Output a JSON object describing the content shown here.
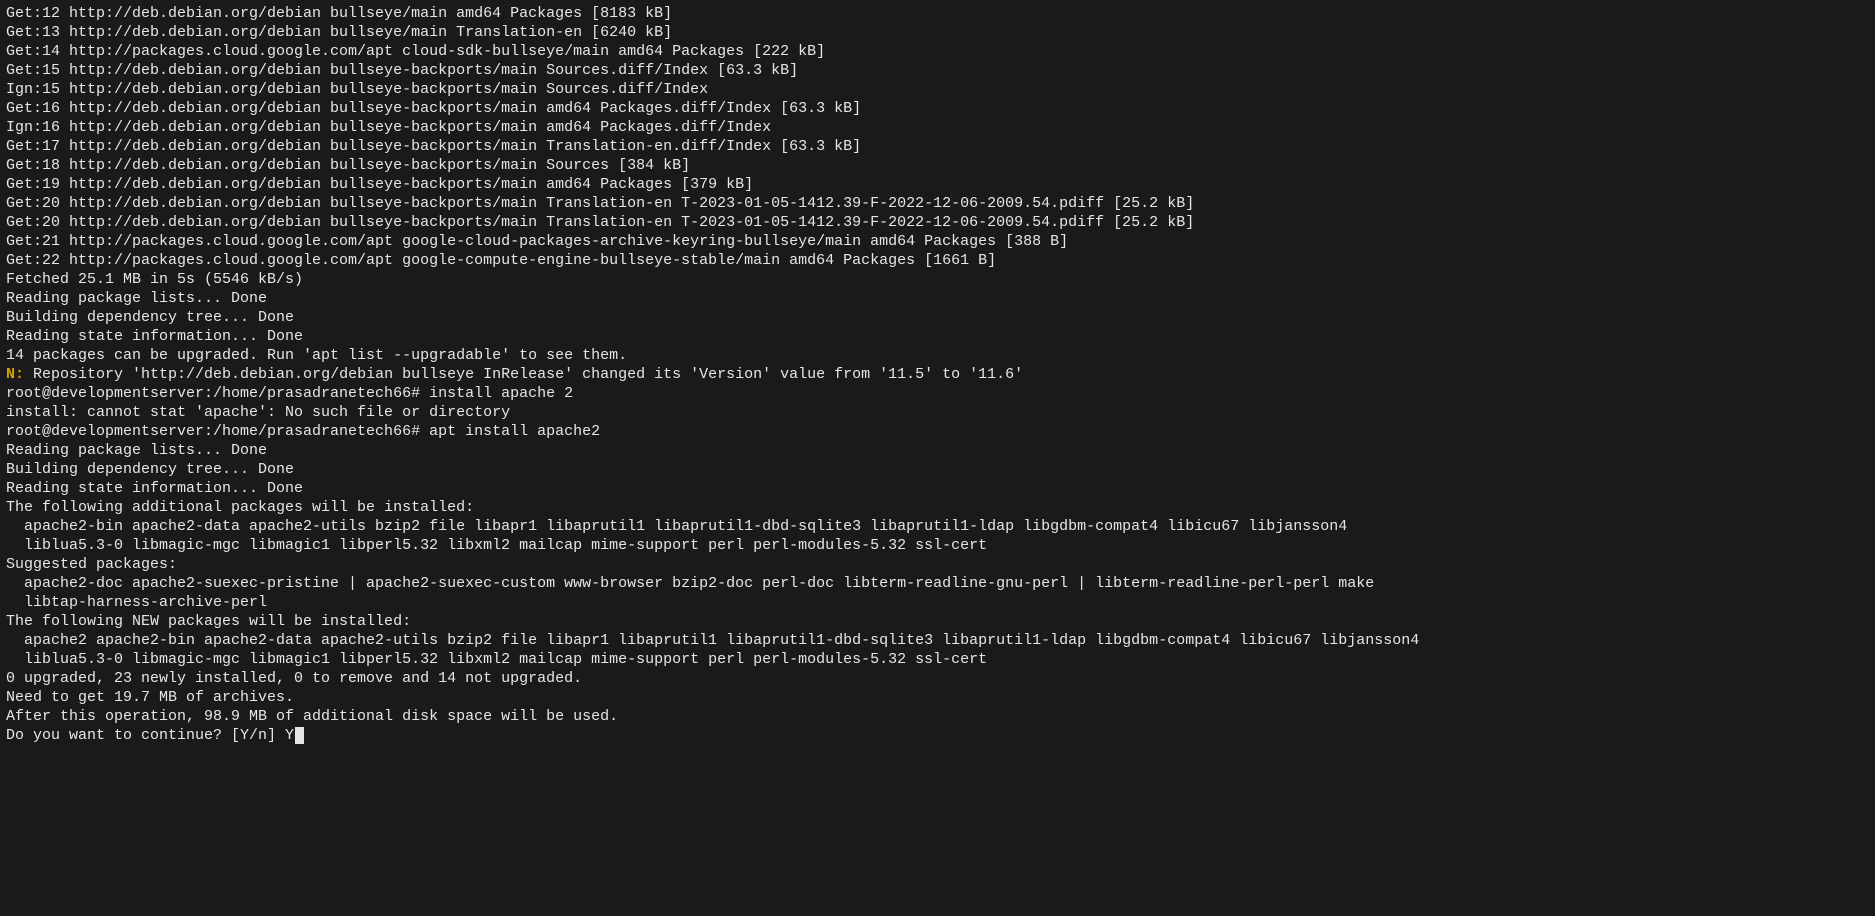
{
  "lines": [
    {
      "text": "Get:12 http://deb.debian.org/debian bullseye/main amd64 Packages [8183 kB]"
    },
    {
      "text": "Get:13 http://deb.debian.org/debian bullseye/main Translation-en [6240 kB]"
    },
    {
      "text": "Get:14 http://packages.cloud.google.com/apt cloud-sdk-bullseye/main amd64 Packages [222 kB]"
    },
    {
      "text": "Get:15 http://deb.debian.org/debian bullseye-backports/main Sources.diff/Index [63.3 kB]"
    },
    {
      "text": "Ign:15 http://deb.debian.org/debian bullseye-backports/main Sources.diff/Index"
    },
    {
      "text": "Get:16 http://deb.debian.org/debian bullseye-backports/main amd64 Packages.diff/Index [63.3 kB]"
    },
    {
      "text": "Ign:16 http://deb.debian.org/debian bullseye-backports/main amd64 Packages.diff/Index"
    },
    {
      "text": "Get:17 http://deb.debian.org/debian bullseye-backports/main Translation-en.diff/Index [63.3 kB]"
    },
    {
      "text": "Get:18 http://deb.debian.org/debian bullseye-backports/main Sources [384 kB]"
    },
    {
      "text": "Get:19 http://deb.debian.org/debian bullseye-backports/main amd64 Packages [379 kB]"
    },
    {
      "text": "Get:20 http://deb.debian.org/debian bullseye-backports/main Translation-en T-2023-01-05-1412.39-F-2022-12-06-2009.54.pdiff [25.2 kB]"
    },
    {
      "text": "Get:20 http://deb.debian.org/debian bullseye-backports/main Translation-en T-2023-01-05-1412.39-F-2022-12-06-2009.54.pdiff [25.2 kB]"
    },
    {
      "text": "Get:21 http://packages.cloud.google.com/apt google-cloud-packages-archive-keyring-bullseye/main amd64 Packages [388 B]"
    },
    {
      "text": "Get:22 http://packages.cloud.google.com/apt google-compute-engine-bullseye-stable/main amd64 Packages [1661 B]"
    },
    {
      "text": "Fetched 25.1 MB in 5s (5546 kB/s)"
    },
    {
      "text": "Reading package lists... Done"
    },
    {
      "text": "Building dependency tree... Done"
    },
    {
      "text": "Reading state information... Done"
    },
    {
      "text": "14 packages can be upgraded. Run 'apt list --upgradable' to see them."
    },
    {
      "prefix": "N:",
      "text": " Repository 'http://deb.debian.org/debian bullseye InRelease' changed its 'Version' value from '11.5' to '11.6'"
    },
    {
      "text": "root@developmentserver:/home/prasadranetech66# install apache 2"
    },
    {
      "text": "install: cannot stat 'apache': No such file or directory"
    },
    {
      "text": "root@developmentserver:/home/prasadranetech66# apt install apache2"
    },
    {
      "text": "Reading package lists... Done"
    },
    {
      "text": "Building dependency tree... Done"
    },
    {
      "text": "Reading state information... Done"
    },
    {
      "text": "The following additional packages will be installed:"
    },
    {
      "text": "  apache2-bin apache2-data apache2-utils bzip2 file libapr1 libaprutil1 libaprutil1-dbd-sqlite3 libaprutil1-ldap libgdbm-compat4 libicu67 libjansson4"
    },
    {
      "text": "  liblua5.3-0 libmagic-mgc libmagic1 libperl5.32 libxml2 mailcap mime-support perl perl-modules-5.32 ssl-cert"
    },
    {
      "text": "Suggested packages:"
    },
    {
      "text": "  apache2-doc apache2-suexec-pristine | apache2-suexec-custom www-browser bzip2-doc perl-doc libterm-readline-gnu-perl | libterm-readline-perl-perl make"
    },
    {
      "text": "  libtap-harness-archive-perl"
    },
    {
      "text": "The following NEW packages will be installed:"
    },
    {
      "text": "  apache2 apache2-bin apache2-data apache2-utils bzip2 file libapr1 libaprutil1 libaprutil1-dbd-sqlite3 libaprutil1-ldap libgdbm-compat4 libicu67 libjansson4"
    },
    {
      "text": "  liblua5.3-0 libmagic-mgc libmagic1 libperl5.32 libxml2 mailcap mime-support perl perl-modules-5.32 ssl-cert"
    },
    {
      "text": "0 upgraded, 23 newly installed, 0 to remove and 14 not upgraded."
    },
    {
      "text": "Need to get 19.7 MB of archives."
    },
    {
      "text": "After this operation, 98.9 MB of additional disk space will be used."
    }
  ],
  "prompt": {
    "question": "Do you want to continue? [Y/n] ",
    "input": "Y"
  }
}
